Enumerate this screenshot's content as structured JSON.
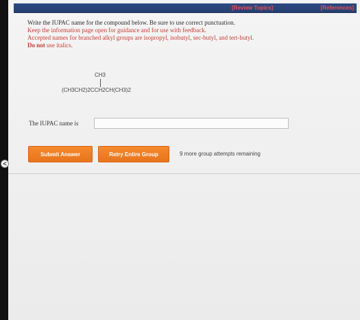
{
  "header": {
    "review_topics": "[Review Topics]",
    "references": "[References]"
  },
  "question": {
    "line1": "Write the IUPAC name for the compound below. Be sure to use correct punctuation.",
    "line2": "Keep the information page open for guidance and for use with feedback.",
    "line3": "Accepted names for branched alkyl groups are isopropyl, isobutyl, sec-butyl, and tert-butyl.",
    "line4_bold": "Do not",
    "line4_rest": " use italics."
  },
  "structure": {
    "top_group": "CH3",
    "formula": "(CH3CH2)2CCH2CH(CH3)2"
  },
  "answer": {
    "label": "The IUPAC name is",
    "placeholder": ""
  },
  "buttons": {
    "submit": "Submit Answer",
    "retry": "Retry Entire Group"
  },
  "status": {
    "attempts": "9 more group attempts remaining"
  },
  "nav": {
    "collapse_symbol": "<"
  },
  "colors": {
    "top_bar": "#2f4a83",
    "link_red": "#e84f4f",
    "instruction_red": "#c43c34",
    "button_orange": "#f58a2c"
  },
  "icons": {
    "collapse": "chevron-left-icon"
  }
}
